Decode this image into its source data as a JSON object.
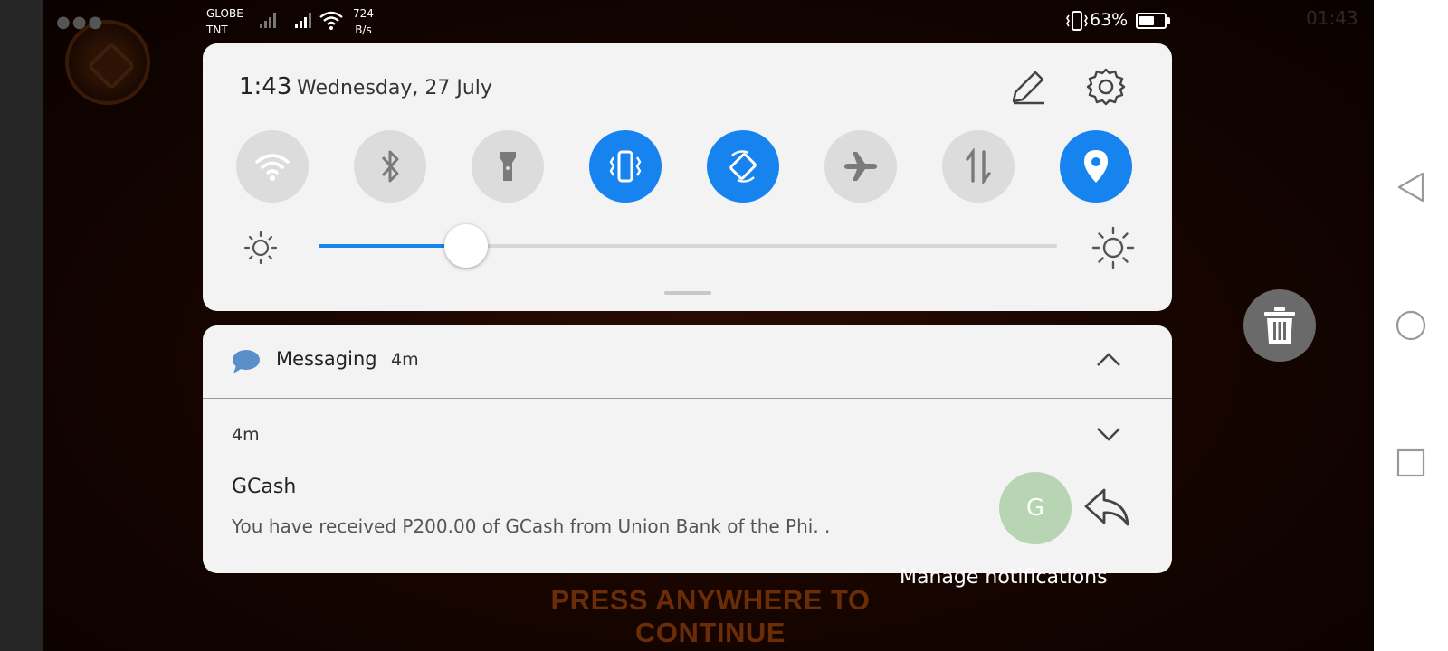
{
  "status_bar": {
    "carrier_line1": "GLOBE",
    "carrier_line2": "TNT",
    "net_speed_value": "724",
    "net_speed_unit": "B/s",
    "battery_percent": "63%",
    "battery_level": 0.63,
    "clock": "01:43"
  },
  "quick_settings": {
    "time": "1:43",
    "date": "Wednesday, 27 July",
    "toggles": [
      {
        "name": "wifi",
        "on": true
      },
      {
        "name": "bluetooth",
        "on": false
      },
      {
        "name": "flashlight",
        "on": false
      },
      {
        "name": "vibrate",
        "on": true
      },
      {
        "name": "auto-rotate",
        "on": true
      },
      {
        "name": "airplane-mode",
        "on": false
      },
      {
        "name": "mobile-data",
        "on": false
      },
      {
        "name": "location",
        "on": true
      }
    ],
    "brightness_level": 0.2
  },
  "notification": {
    "app_name": "Messaging",
    "header_time": "4m",
    "message_time": "4m",
    "sender": "GCash",
    "body": "You have received P200.00 of GCash from Union Bank of the Phi. .",
    "avatar_letter": "G"
  },
  "manage_notifications": "Manage notifications",
  "background": {
    "press_text": "PRESS ANYWHERE TO CONTINUE"
  },
  "colors": {
    "accent": "#1683ee",
    "toggle_off": "#dcdcdc",
    "panel": "#f3f3f3",
    "avatar": "#b7d4b3"
  }
}
